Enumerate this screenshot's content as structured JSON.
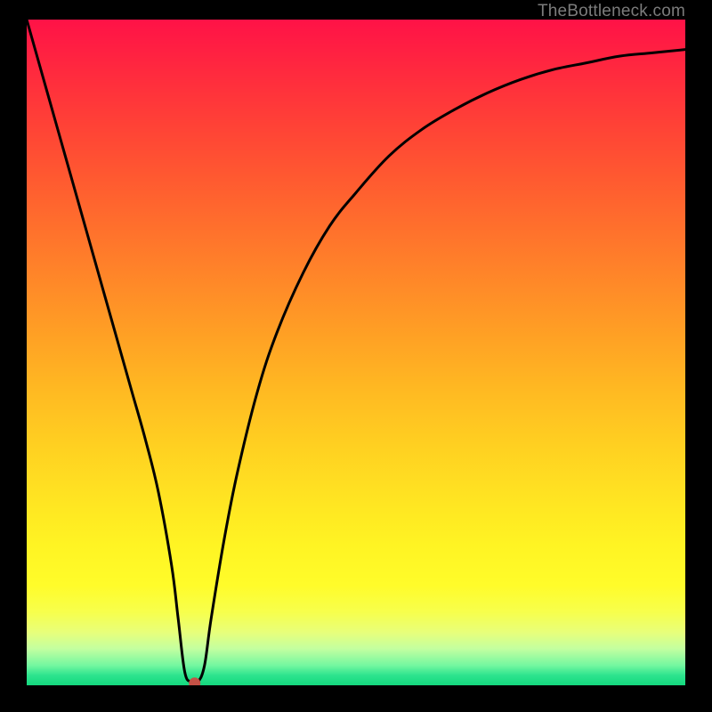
{
  "watermark": "TheBottleneck.com",
  "chart_data": {
    "type": "line",
    "title": "",
    "xlabel": "",
    "ylabel": "",
    "xlim": [
      0,
      100
    ],
    "ylim": [
      0,
      100
    ],
    "x": [
      0,
      2,
      4,
      6,
      8,
      10,
      12,
      14,
      16,
      18,
      20,
      22,
      23,
      24,
      25,
      26,
      27,
      28,
      30,
      32,
      35,
      38,
      42,
      46,
      50,
      55,
      60,
      65,
      70,
      75,
      80,
      85,
      90,
      95,
      100
    ],
    "values": [
      100,
      93,
      86,
      79,
      72,
      65,
      58,
      51,
      44,
      37,
      29,
      18,
      10,
      2,
      0.5,
      0.5,
      3,
      10,
      22,
      32,
      44,
      53,
      62,
      69,
      74,
      79.5,
      83.5,
      86.5,
      89,
      91,
      92.5,
      93.5,
      94.5,
      95,
      95.5
    ],
    "marker": {
      "x": 25.5,
      "y": 0.3
    },
    "background_gradient": {
      "top_color": "#ff1247",
      "mid_color": "#ffd021",
      "bottom_color": "#14d87e"
    },
    "annotations": []
  }
}
